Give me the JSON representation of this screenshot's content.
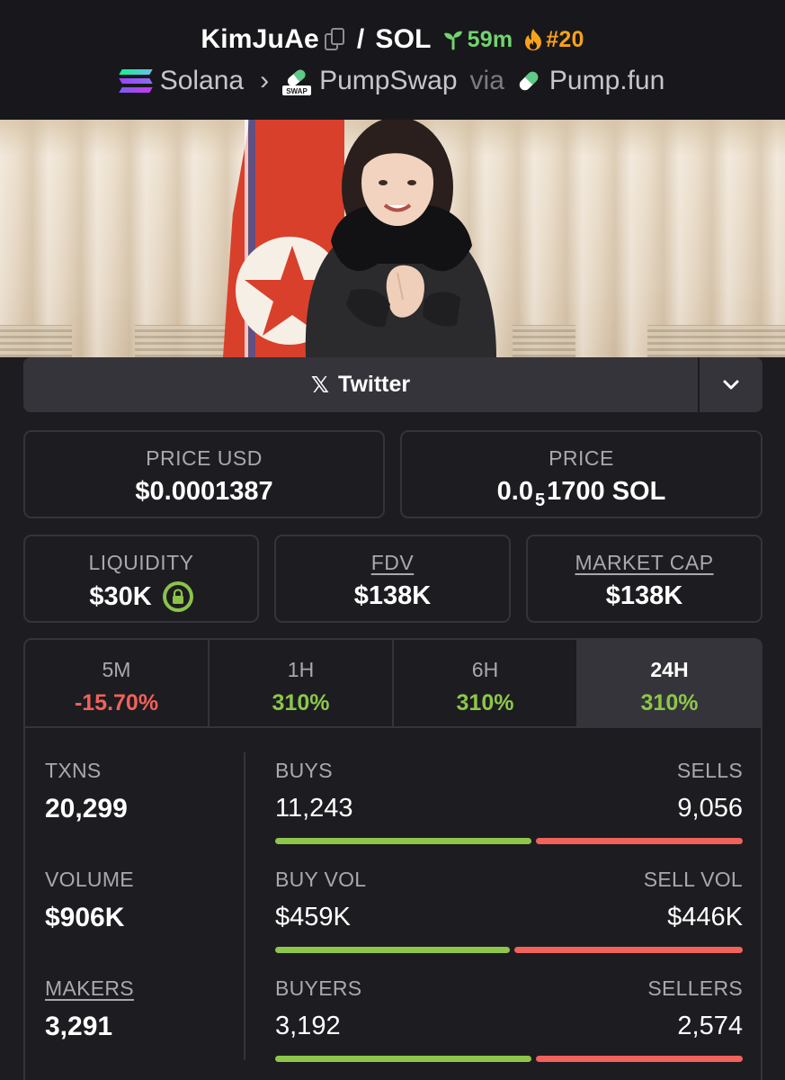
{
  "header": {
    "token": "KimJuAe",
    "quote": "SOL",
    "age": "59m",
    "rank": "#20",
    "chain": "Solana",
    "dex": "PumpSwap",
    "via_label": "via",
    "launchpad": "Pump.fun",
    "swap_icon_text": "SWAP"
  },
  "social": {
    "x_glyph": "𝕏",
    "label": "Twitter"
  },
  "prices": {
    "usd_label": "PRICE USD",
    "usd_value": "$0.0001387",
    "native_label": "PRICE",
    "native_prefix": "0.0",
    "native_sub": "5",
    "native_suffix": "1700 SOL"
  },
  "stats": {
    "liquidity_label": "LIQUIDITY",
    "liquidity_value": "$30K",
    "fdv_label": "FDV",
    "fdv_value": "$138K",
    "mcap_label": "MARKET CAP",
    "mcap_value": "$138K"
  },
  "timeframes": [
    {
      "label": "5M",
      "value": "-15.70%",
      "trend": "down"
    },
    {
      "label": "1H",
      "value": "310%",
      "trend": "up"
    },
    {
      "label": "6H",
      "value": "310%",
      "trend": "up"
    },
    {
      "label": "24H",
      "value": "310%",
      "trend": "up",
      "active": true
    }
  ],
  "details": {
    "txns_label": "TXNS",
    "txns_value": "20,299",
    "volume_label": "VOLUME",
    "volume_value": "$906K",
    "makers_label": "MAKERS",
    "makers_value": "3,291",
    "buys_label": "BUYS",
    "buys_value": "11,243",
    "sells_label": "SELLS",
    "sells_value": "9,056",
    "buys_share": 0.554,
    "buy_vol_label": "BUY VOL",
    "buy_vol_value": "$459K",
    "sell_vol_label": "SELL VOL",
    "sell_vol_value": "$446K",
    "buy_vol_share": 0.507,
    "buyers_label": "BUYERS",
    "buyers_value": "3,192",
    "sellers_label": "SELLERS",
    "sellers_value": "2,574",
    "buyers_share": 0.554
  },
  "colors": {
    "positive": "#8dc64a",
    "negative": "#f0625b",
    "age_green": "#72d46d",
    "rank_orange": "#f7a21b",
    "panel_border": "#35343a"
  }
}
